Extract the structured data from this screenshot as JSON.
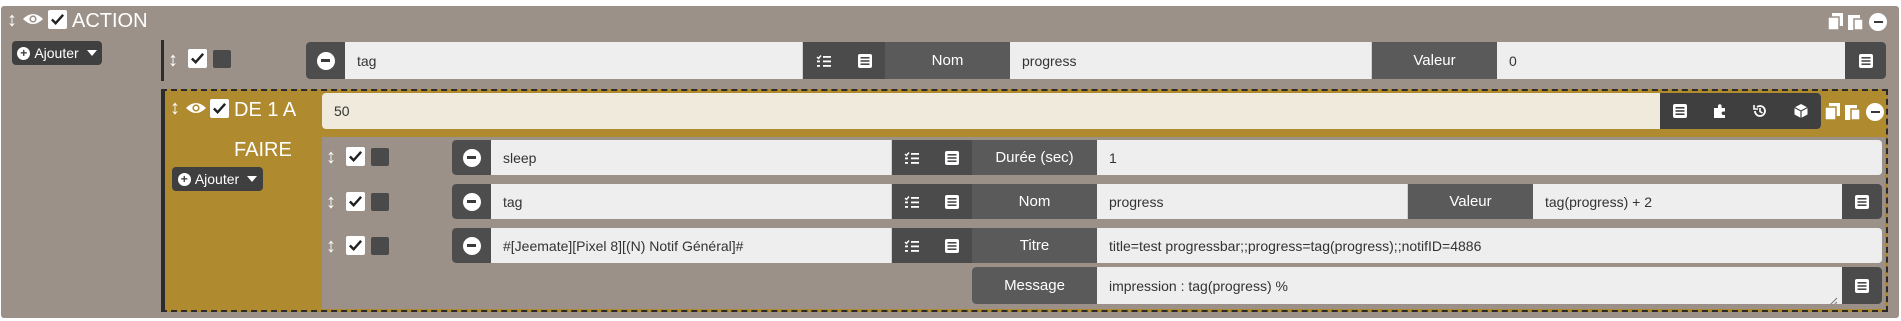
{
  "action": {
    "title": "ACTION",
    "add_label": "Ajouter"
  },
  "tag_row": {
    "name_value": "tag",
    "nom_label": "Nom",
    "nom_value": "progress",
    "valeur_label": "Valeur",
    "valeur_value": "0"
  },
  "loop": {
    "title": "DE 1 A",
    "count_value": "50",
    "faire_label": "FAIRE",
    "add_label": "Ajouter",
    "rows": [
      {
        "cmd": "sleep",
        "label1": "Durée (sec)",
        "value1": "1"
      },
      {
        "cmd": "tag",
        "label1": "Nom",
        "value1": "progress",
        "label2": "Valeur",
        "value2": "tag(progress) + 2"
      },
      {
        "cmd": "#[Jeemate][Pixel 8][(N) Notif Général]#",
        "label1": "Titre",
        "value1": "title=test progressbar;;progress=tag(progress);;notifID=4886",
        "label2": "Message",
        "value2": "impression : tag(progress) %"
      }
    ]
  },
  "colors": {
    "action_bg": "#9c9189",
    "loop_bg": "#b08a2e",
    "loop_input_bg": "#efeadc",
    "dark_button": "#3f3f3f"
  },
  "icons": [
    "drag-arrows-icon",
    "eye-icon",
    "check-icon",
    "copy-icon",
    "paste-icon",
    "remove-icon",
    "list-check-icon",
    "list-icon",
    "puzzle-icon",
    "history-icon",
    "cube-icon",
    "plus-circle-icon",
    "caret-down-icon"
  ]
}
